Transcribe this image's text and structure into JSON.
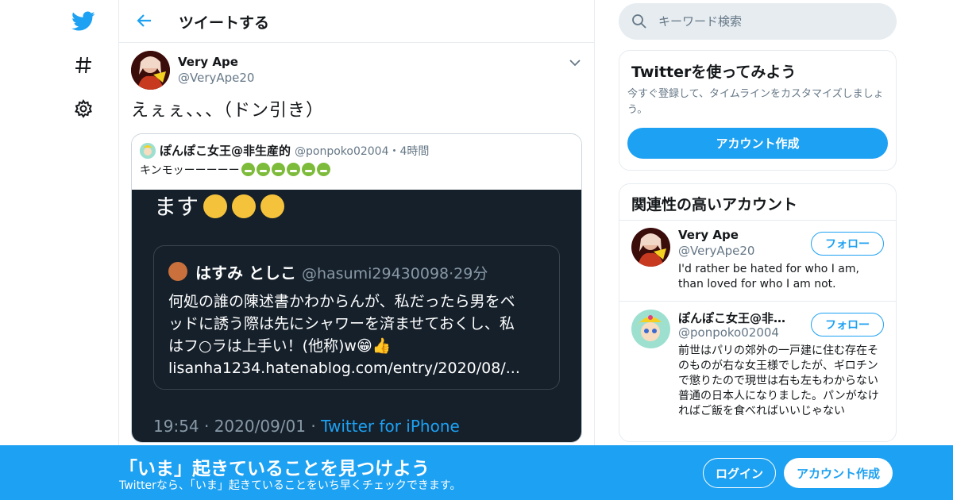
{
  "nav": {
    "icons": [
      "twitter-bird-icon",
      "hashtag-icon",
      "gear-icon"
    ]
  },
  "header": {
    "title": "ツイートする"
  },
  "tweet": {
    "author_name": "Very Ape",
    "author_handle": "@VeryApe20",
    "text": "えぇぇ、、、（ドン引き）",
    "quote": {
      "name": "ぽんぽこ女王@非生産的",
      "handle": "@ponpoko02004・4時間",
      "text": "キンモッーーーーー",
      "emoji_count": 6,
      "image": {
        "top_text": "ます",
        "inner_name": "はすみ としこ",
        "inner_handle": "@hasumi29430098·29分",
        "inner_lines": [
          "何処の誰の陳述書かわからんが、私だったら男をベ",
          "ッドに誘う際は先にシャワーを済ませておくし、私",
          "はフ○ラは上手い！(他称)w😁👍",
          "lisanha1234.hatenablog.com/entry/2020/08/..."
        ],
        "footer_time": "19:54 · 2020/09/01 · ",
        "footer_source": "Twitter for iPhone"
      }
    }
  },
  "search": {
    "placeholder": "キーワード検索"
  },
  "signup_panel": {
    "title": "Twitterを使ってみよう",
    "desc": "今すぐ登録して、タイムラインをカスタマイズしましょう。",
    "button": "アカウント作成"
  },
  "related": {
    "title": "関連性の高いアカウント",
    "accounts": [
      {
        "name": "Very Ape",
        "handle": "@VeryApe20",
        "bio": "I'd rather be hated for who I am, than loved for who I am not.",
        "follow": "フォロー"
      },
      {
        "name": "ぽんぽこ女王@非生産的",
        "handle": "@ponpoko02004",
        "bio": "前世はパリの郊外の一戸建に住む存在そのものが右な女王様でしたが、ギロチンで懲りたので現世は右も左もわからない普通の日本人になりました。パンがなければご飯を食べればいいじゃない",
        "follow": "フォロー"
      }
    ]
  },
  "bottom": {
    "title": "「いま」起きていることを見つけよう",
    "subtitle": "Twitterなら、「いま」起きていることをいち早くチェックできます。",
    "login": "ログイン",
    "signup": "アカウント作成"
  },
  "colors": {
    "accent": "#1da1f2",
    "border": "#e6ecf0",
    "dark_bg": "#15202b"
  }
}
